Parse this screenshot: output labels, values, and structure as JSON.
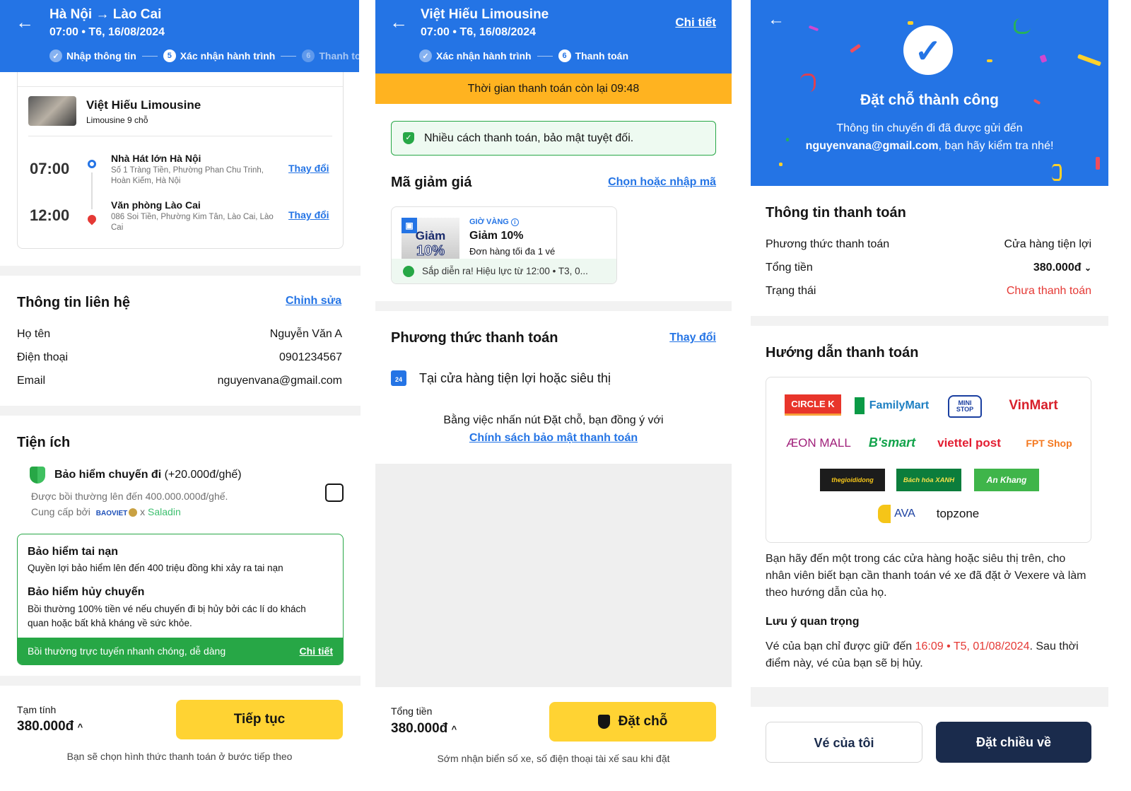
{
  "left": {
    "header": {
      "title": "Hà Nội → Lào Cai",
      "subtitle": "07:00 • T6, 16/08/2024",
      "steps": [
        {
          "num": "",
          "label": "Nhập thông tin",
          "state": "done"
        },
        {
          "num": "5",
          "label": "Xác nhận hành trình",
          "state": "active"
        },
        {
          "num": "6",
          "label": "Thanh toán",
          "state": "pending"
        }
      ]
    },
    "trip": {
      "operator": "Việt Hiếu Limousine",
      "vehicle": "Limousine 9 chỗ",
      "change_label": "Thay đổi",
      "stops": [
        {
          "time": "07:00",
          "name": "Nhà Hát lớn Hà Nội",
          "address": "Số 1 Tràng Tiền, Phường Phan Chu Trinh, Hoàn Kiếm, Hà Nội"
        },
        {
          "time": "12:00",
          "name": "Văn phòng Lào Cai",
          "address": "086 Soi Tiền, Phường Kim Tân, Lào Cai, Lào Cai"
        }
      ]
    },
    "contact": {
      "title": "Thông tin liên hệ",
      "edit": "Chỉnh sửa",
      "rows": [
        {
          "label": "Họ tên",
          "value": "Nguyễn Văn A"
        },
        {
          "label": "Điện thoại",
          "value": "0901234567"
        },
        {
          "label": "Email",
          "value": "nguyenvana@gmail.com"
        }
      ]
    },
    "utilities": {
      "title": "Tiện ích",
      "insurance_title": "Bảo hiểm chuyến đi",
      "insurance_price": "(+20.000đ/ghế)",
      "insurance_desc": "Được bồi thường lên đến 400.000.000đ/ghế.",
      "provider_prefix": "Cung cấp bởi",
      "provider1": "BAOVIET",
      "x": "x",
      "provider2": "Saladin",
      "checked": false,
      "box": {
        "t1": "Bảo hiểm tai nạn",
        "d1": "Quyền lợi bảo hiểm lên đến 400 triệu đồng khi xảy ra tai nạn",
        "t2": "Bảo hiểm hủy chuyến",
        "d2": "Bồi thường 100% tiền vé nếu chuyến đi bị hủy bởi các lí do khách quan hoặc bất khả kháng về sức khỏe.",
        "footer": "Bồi thường trực tuyến nhanh chóng, dễ dàng",
        "footer_link": "Chi tiết"
      }
    },
    "footer": {
      "label": "Tạm tính",
      "amount": "380.000đ",
      "button": "Tiếp tục",
      "note": "Bạn sẽ chọn hình thức thanh toán ở bước tiếp theo"
    }
  },
  "middle": {
    "header": {
      "title": "Việt Hiếu Limousine",
      "subtitle": "07:00 • T6, 16/08/2024",
      "detail": "Chi tiết",
      "steps": [
        {
          "label": "Xác nhận hành trình",
          "state": "done"
        },
        {
          "num": "6",
          "label": "Thanh toán",
          "state": "active"
        }
      ]
    },
    "timer": "Thời gian thanh toán còn lại 09:48",
    "secure_note": "Nhiều cách thanh toán, bảo mật tuyệt đối.",
    "discount": {
      "title": "Mã giảm giá",
      "action": "Chọn hoặc nhập mã",
      "img_line1": "Giảm",
      "img_line2": "10%",
      "tag": "GIỜ VÀNG",
      "name": "Giảm 10%",
      "cond": "Đơn hàng tối đa 1 vé",
      "status": "Sắp diễn ra! Hiệu lực từ 12:00 • T3, 0..."
    },
    "payment": {
      "title": "Phương thức thanh toán",
      "change": "Thay đổi",
      "method": "Tại cửa hàng tiện lợi hoặc siêu thị",
      "agree": "Bằng việc nhấn nút Đặt chỗ, bạn đồng ý với",
      "policy": "Chính sách bảo mật thanh toán"
    },
    "footer": {
      "label": "Tổng tiền",
      "amount": "380.000đ",
      "button": "Đặt chỗ",
      "note": "Sớm nhận biển số xe, số điện thoại tài xế sau khi đặt"
    }
  },
  "right": {
    "hero": {
      "title": "Đặt chỗ thành công",
      "line1": "Thông tin chuyến đi đã được gửi đến",
      "email": "nguyenvana@gmail.com",
      "line2": ", bạn hãy kiểm tra nhé!"
    },
    "payment_info": {
      "title": "Thông tin thanh toán",
      "rows": [
        {
          "label": "Phương thức thanh toán",
          "value": "Cửa hàng tiện lợi"
        },
        {
          "label": "Tổng tiền",
          "value": "380.000đ"
        },
        {
          "label": "Trạng thái",
          "value": "Chưa thanh toán"
        }
      ]
    },
    "guide": {
      "title": "Hướng dẫn thanh toán",
      "stores": [
        "CIRCLE K",
        "FamilyMart",
        "MINI STOP",
        "VinMart",
        "ÆON MALL",
        "B'smart",
        "viettel post",
        "FPT Shop",
        "thegioididong",
        "Bách hóa XANH",
        "An Khang",
        "AVA",
        "topzone"
      ],
      "text": "Bạn hãy đến một trong các cửa hàng hoặc siêu thị trên, cho nhân viên biết bạn cần thanh toán vé xe đã đặt ở Vexere và làm theo hướng dẫn của họ.",
      "note_title": "Lưu ý quan trọng",
      "note_pre": "Vé của bạn chỉ được giữ đến ",
      "note_deadline": "16:09 • T5, 01/08/2024",
      "note_post": ". Sau thời điểm này, vé của bạn sẽ bị hủy."
    },
    "buttons": {
      "my_tickets": "Vé của tôi",
      "return_trip": "Đặt chiều về"
    }
  },
  "colors": {
    "primary": "#2474e5",
    "yellow": "#ffd333",
    "timer": "#ffb320",
    "green": "#27a746",
    "red": "#e53935",
    "navy": "#1a2b4c"
  }
}
